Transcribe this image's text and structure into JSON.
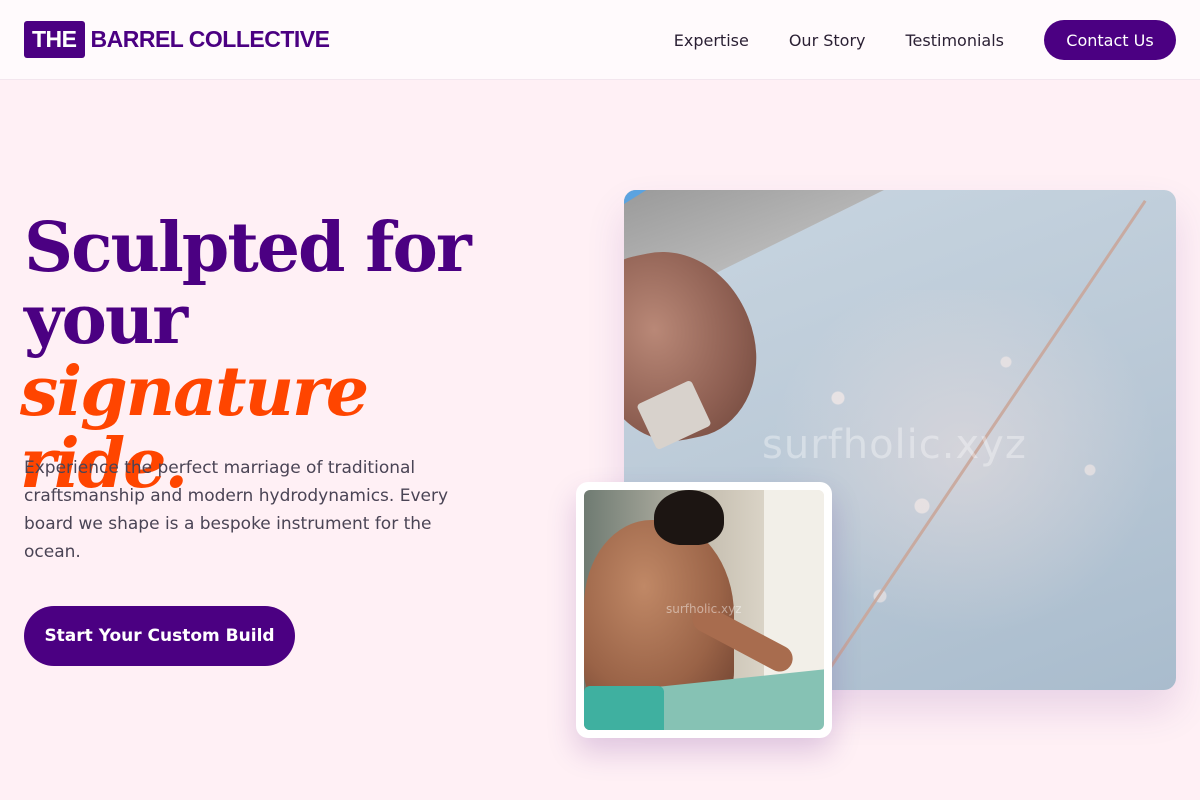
{
  "header": {
    "logo_box": "THE",
    "logo_text": "BARREL COLLECTIVE",
    "nav": [
      {
        "label": "Expertise"
      },
      {
        "label": "Our Story"
      },
      {
        "label": "Testimonials"
      }
    ],
    "contact_label": "Contact Us"
  },
  "hero": {
    "headline_line1": "Sculpted for",
    "headline_line2": "your",
    "headline_accent": "signature ride.",
    "subtext": "Experience the perfect marriage of traditional craftsmanship and modern hydrodynamics. Every board we shape is a bespoke instrument for the ocean.",
    "cta_label": "Start Your Custom Build",
    "main_image_watermark": "surfholic.xyz",
    "inset_image_watermark": "surfholic.xyz"
  },
  "colors": {
    "brand": "#4b0082",
    "accent": "#ff4500",
    "background": "#fff0f5"
  }
}
